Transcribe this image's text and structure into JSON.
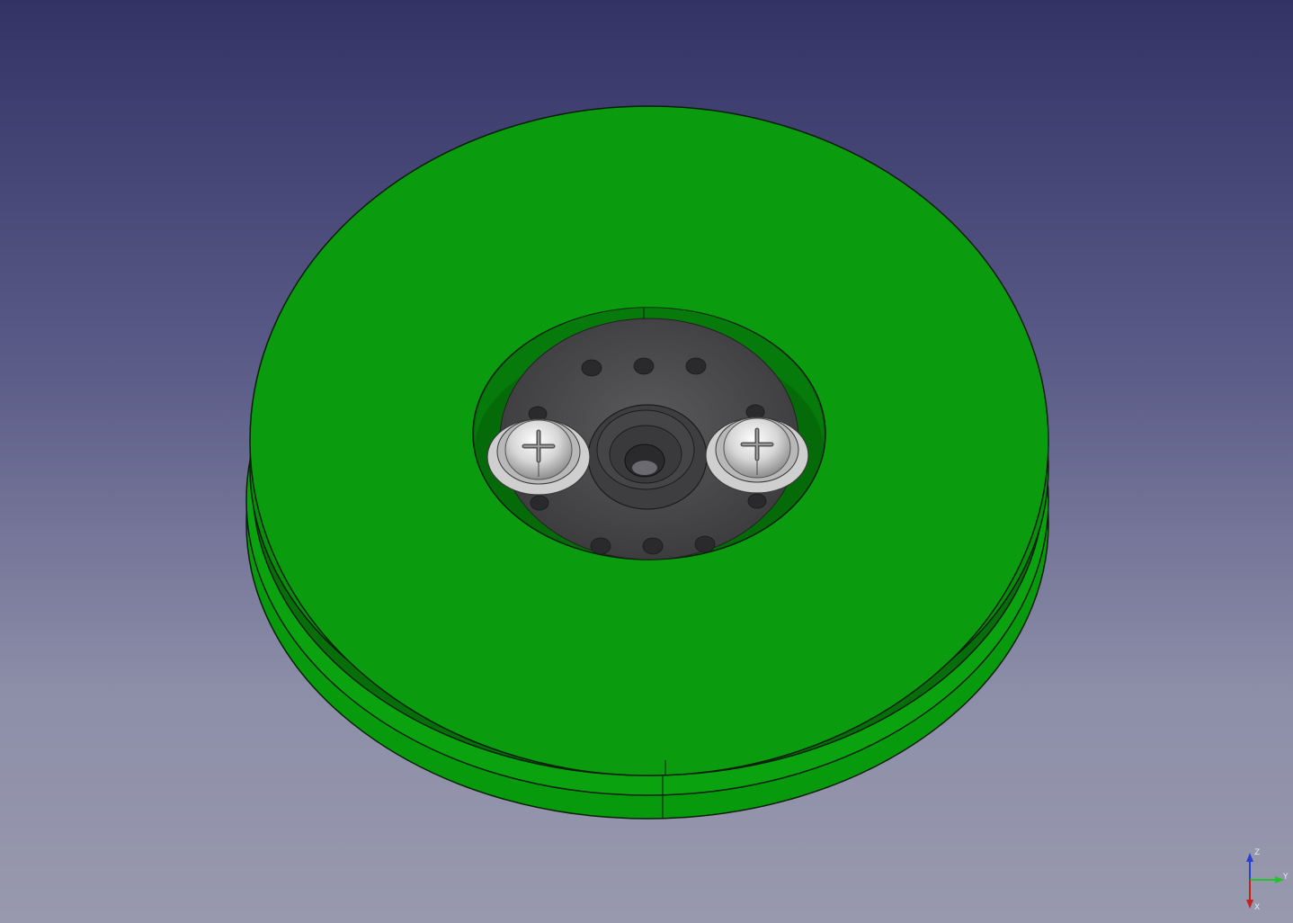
{
  "app": {
    "view": "3D view"
  },
  "model": {
    "parts": [
      {
        "name": "pulley-wheel",
        "color": "#0a9a0e"
      },
      {
        "name": "servo-horn",
        "color": "#4a4a4c"
      },
      {
        "name": "screw-left",
        "color": "#d0d0d0"
      },
      {
        "name": "screw-right",
        "color": "#d0d0d0"
      }
    ]
  },
  "navigation": {
    "axis_labels": {
      "z": "Z",
      "y": "Y",
      "x": "X"
    },
    "axis_colors": {
      "z": "#2a3fd6",
      "y": "#22c229",
      "x": "#c62222"
    }
  },
  "colors": {
    "background_top": "#333366",
    "background_bottom": "#9899ae",
    "wheel_green": "#0a9a0e",
    "wheel_side": "#078c0b",
    "edge": "#0b1e0b"
  }
}
